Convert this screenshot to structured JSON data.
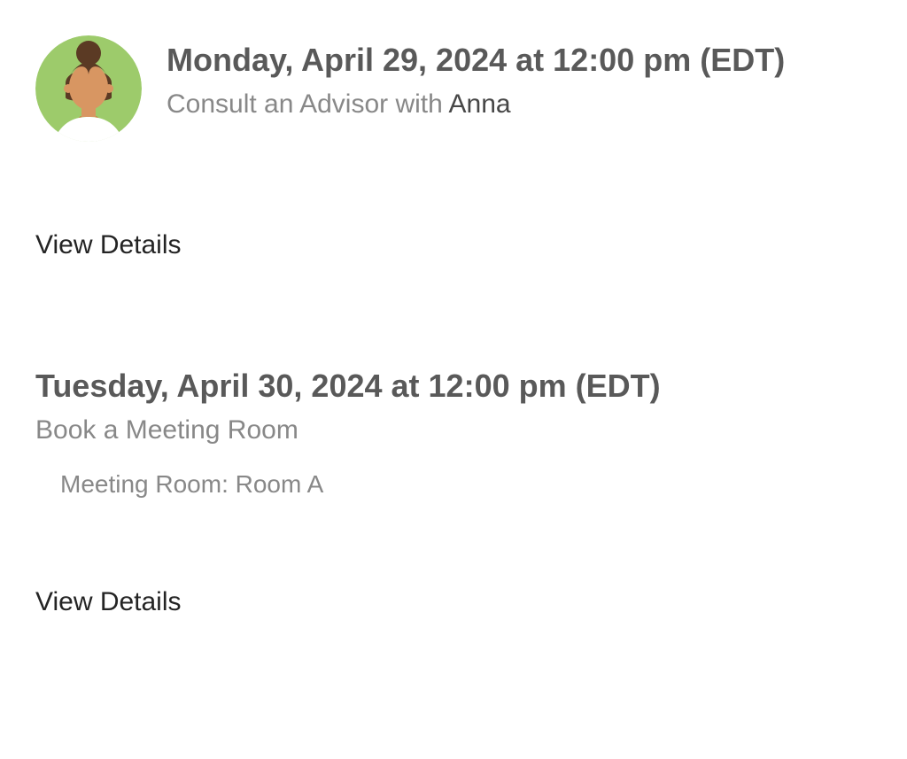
{
  "appointments": [
    {
      "datetime": "Monday, April 29, 2024 at 12:00 pm (EDT)",
      "subtitle_prefix": "Consult an Advisor with ",
      "person": "Anna",
      "view_details_label": "View Details"
    },
    {
      "datetime": "Tuesday, April 30, 2024 at 12:00 pm (EDT)",
      "subtitle": "Book a Meeting Room",
      "meta": "Meeting Room: Room A",
      "view_details_label": "View Details"
    }
  ]
}
